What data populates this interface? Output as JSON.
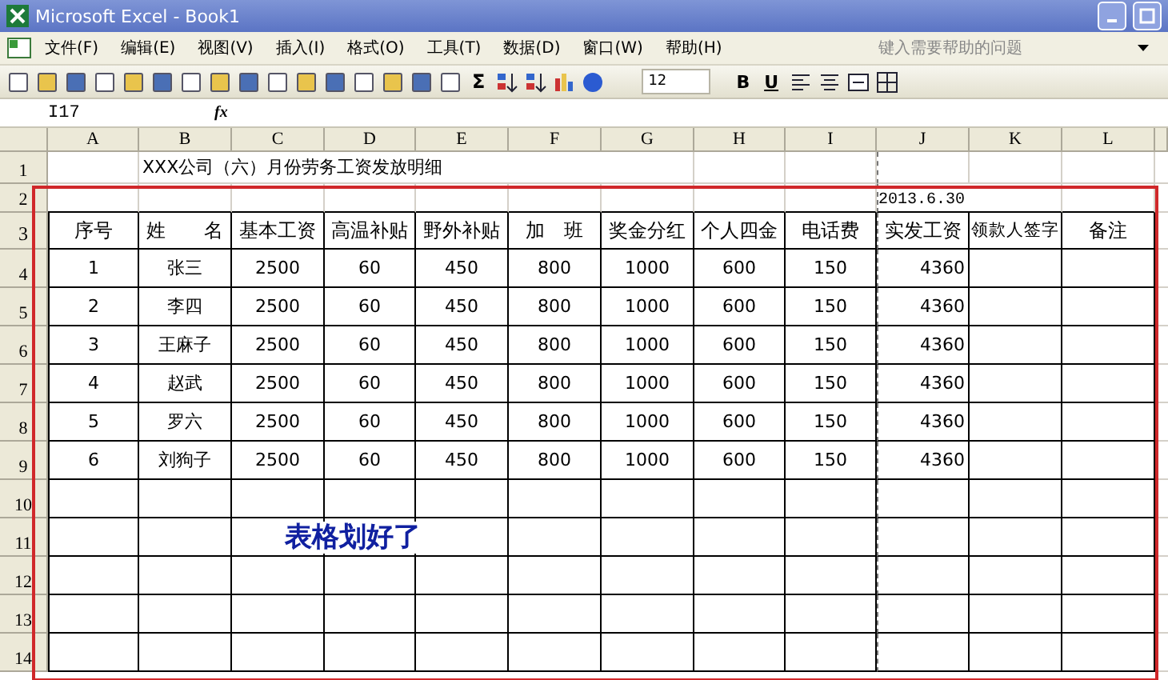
{
  "window": {
    "title": "Microsoft Excel - Book1"
  },
  "menu": [
    "文件(F)",
    "编辑(E)",
    "视图(V)",
    "插入(I)",
    "格式(O)",
    "工具(T)",
    "数据(D)",
    "窗口(W)",
    "帮助(H)"
  ],
  "help_search": {
    "placeholder": "键入需要帮助的问题"
  },
  "toolbar": {
    "font_size": "12",
    "bold": "B",
    "underline": "U",
    "sum": "Σ"
  },
  "formula_bar": {
    "name_box": "I17",
    "fx": "fx"
  },
  "sheet": {
    "columns": [
      "A",
      "B",
      "C",
      "D",
      "E",
      "F",
      "G",
      "H",
      "I",
      "J",
      "K",
      "L"
    ],
    "title_row": {
      "header": "1",
      "text": "XXX公司（六）月份劳务工资发放明细"
    },
    "date_row": {
      "header": "2",
      "text": "2013.6.30"
    },
    "head_row": {
      "header": "3",
      "cells": [
        "序号",
        "姓　　名",
        "基本工资",
        "高温补贴",
        "野外补贴",
        "加　班",
        "奖金分红",
        "个人四金",
        "电话费",
        "实发工资",
        "领款人签字",
        "备注"
      ]
    },
    "rows": [
      {
        "header": "4",
        "cells": [
          "1",
          "张三",
          "2500",
          "60",
          "450",
          "800",
          "1000",
          "600",
          "150",
          "4360"
        ]
      },
      {
        "header": "5",
        "cells": [
          "2",
          "李四",
          "2500",
          "60",
          "450",
          "800",
          "1000",
          "600",
          "150",
          "4360"
        ]
      },
      {
        "header": "6",
        "cells": [
          "3",
          "王麻子",
          "2500",
          "60",
          "450",
          "800",
          "1000",
          "600",
          "150",
          "4360"
        ]
      },
      {
        "header": "7",
        "cells": [
          "4",
          "赵武",
          "2500",
          "60",
          "450",
          "800",
          "1000",
          "600",
          "150",
          "4360"
        ]
      },
      {
        "header": "8",
        "cells": [
          "5",
          "罗六",
          "2500",
          "60",
          "450",
          "800",
          "1000",
          "600",
          "150",
          "4360"
        ]
      },
      {
        "header": "9",
        "cells": [
          "6",
          "刘狗子",
          "2500",
          "60",
          "450",
          "800",
          "1000",
          "600",
          "150",
          "4360"
        ]
      }
    ],
    "empty_rows": [
      "10",
      "11",
      "12",
      "13",
      "14"
    ]
  },
  "annotation": "表格划好了"
}
